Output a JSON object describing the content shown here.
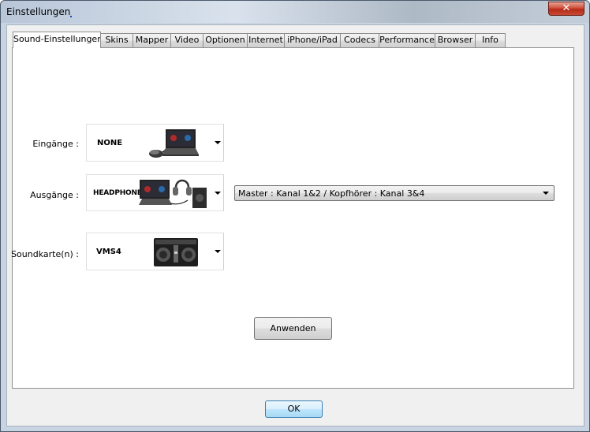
{
  "window": {
    "title": "Einstellungen",
    "close_label": "✕"
  },
  "tabs": [
    {
      "label": "Sound-Einstellungen",
      "active": true
    },
    {
      "label": "Skins"
    },
    {
      "label": "Mapper"
    },
    {
      "label": "Video"
    },
    {
      "label": "Optionen"
    },
    {
      "label": "Internet"
    },
    {
      "label": "iPhone/iPad"
    },
    {
      "label": "Codecs"
    },
    {
      "label": "Performance"
    },
    {
      "label": "Browser"
    },
    {
      "label": "Info"
    }
  ],
  "sound": {
    "inputs": {
      "label": "Eingänge :",
      "value": "NONE",
      "icon": "laptop-mouse-icon"
    },
    "outputs": {
      "label": "Ausgänge :",
      "value": "HEADPHONES",
      "icon": "laptop-headphones-speaker-icon"
    },
    "soundcard": {
      "label": "Soundkarte(n) :",
      "value": "VMS4",
      "icon": "dj-controller-icon"
    },
    "routing": {
      "value": "Master : Kanal 1&2 / Kopfhörer : Kanal 3&4"
    },
    "apply_label": "Anwenden"
  },
  "footer": {
    "ok_label": "OK"
  }
}
